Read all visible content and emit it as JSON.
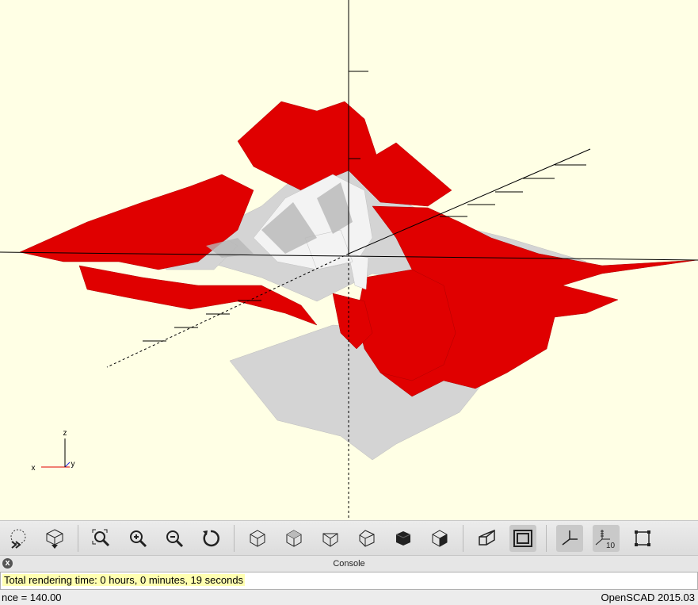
{
  "viewport": {
    "axis_labels": {
      "x": "x",
      "y": "y",
      "z": "z"
    },
    "colors": {
      "background": "#ffffe5",
      "mesh_red": "#e00000",
      "mesh_grey": "#d2d2d2",
      "axis_x": "#e00000",
      "axis_y": "#2020e0"
    }
  },
  "toolbar": {
    "buttons": [
      {
        "name": "preview",
        "icon": "preview-icon"
      },
      {
        "name": "render",
        "icon": "render-icon"
      },
      {
        "name": "view-all",
        "icon": "zoom-all-icon"
      },
      {
        "name": "zoom-in",
        "icon": "zoom-in-icon"
      },
      {
        "name": "zoom-out",
        "icon": "zoom-out-icon"
      },
      {
        "name": "reset-view",
        "icon": "reset-view-icon"
      },
      {
        "name": "right",
        "icon": "view-right-icon"
      },
      {
        "name": "top",
        "icon": "view-top-icon"
      },
      {
        "name": "bottom",
        "icon": "view-bottom-icon"
      },
      {
        "name": "left",
        "icon": "view-left-icon"
      },
      {
        "name": "front",
        "icon": "view-front-icon"
      },
      {
        "name": "back",
        "icon": "view-back-icon"
      },
      {
        "name": "perspective",
        "icon": "perspective-icon"
      },
      {
        "name": "orthogonal",
        "icon": "orthogonal-icon",
        "active": true
      },
      {
        "name": "show-axes",
        "icon": "axes-icon",
        "active": true
      },
      {
        "name": "show-scale-markers",
        "icon": "scale-markers-icon",
        "active": true,
        "label": "10"
      },
      {
        "name": "show-edges",
        "icon": "edges-icon"
      }
    ]
  },
  "console": {
    "title": "Console",
    "close_label": "x",
    "line": "Total rendering time: 0 hours, 0 minutes, 19 seconds"
  },
  "status": {
    "left": "nce = 140.00",
    "right": "OpenSCAD 2015.03"
  }
}
